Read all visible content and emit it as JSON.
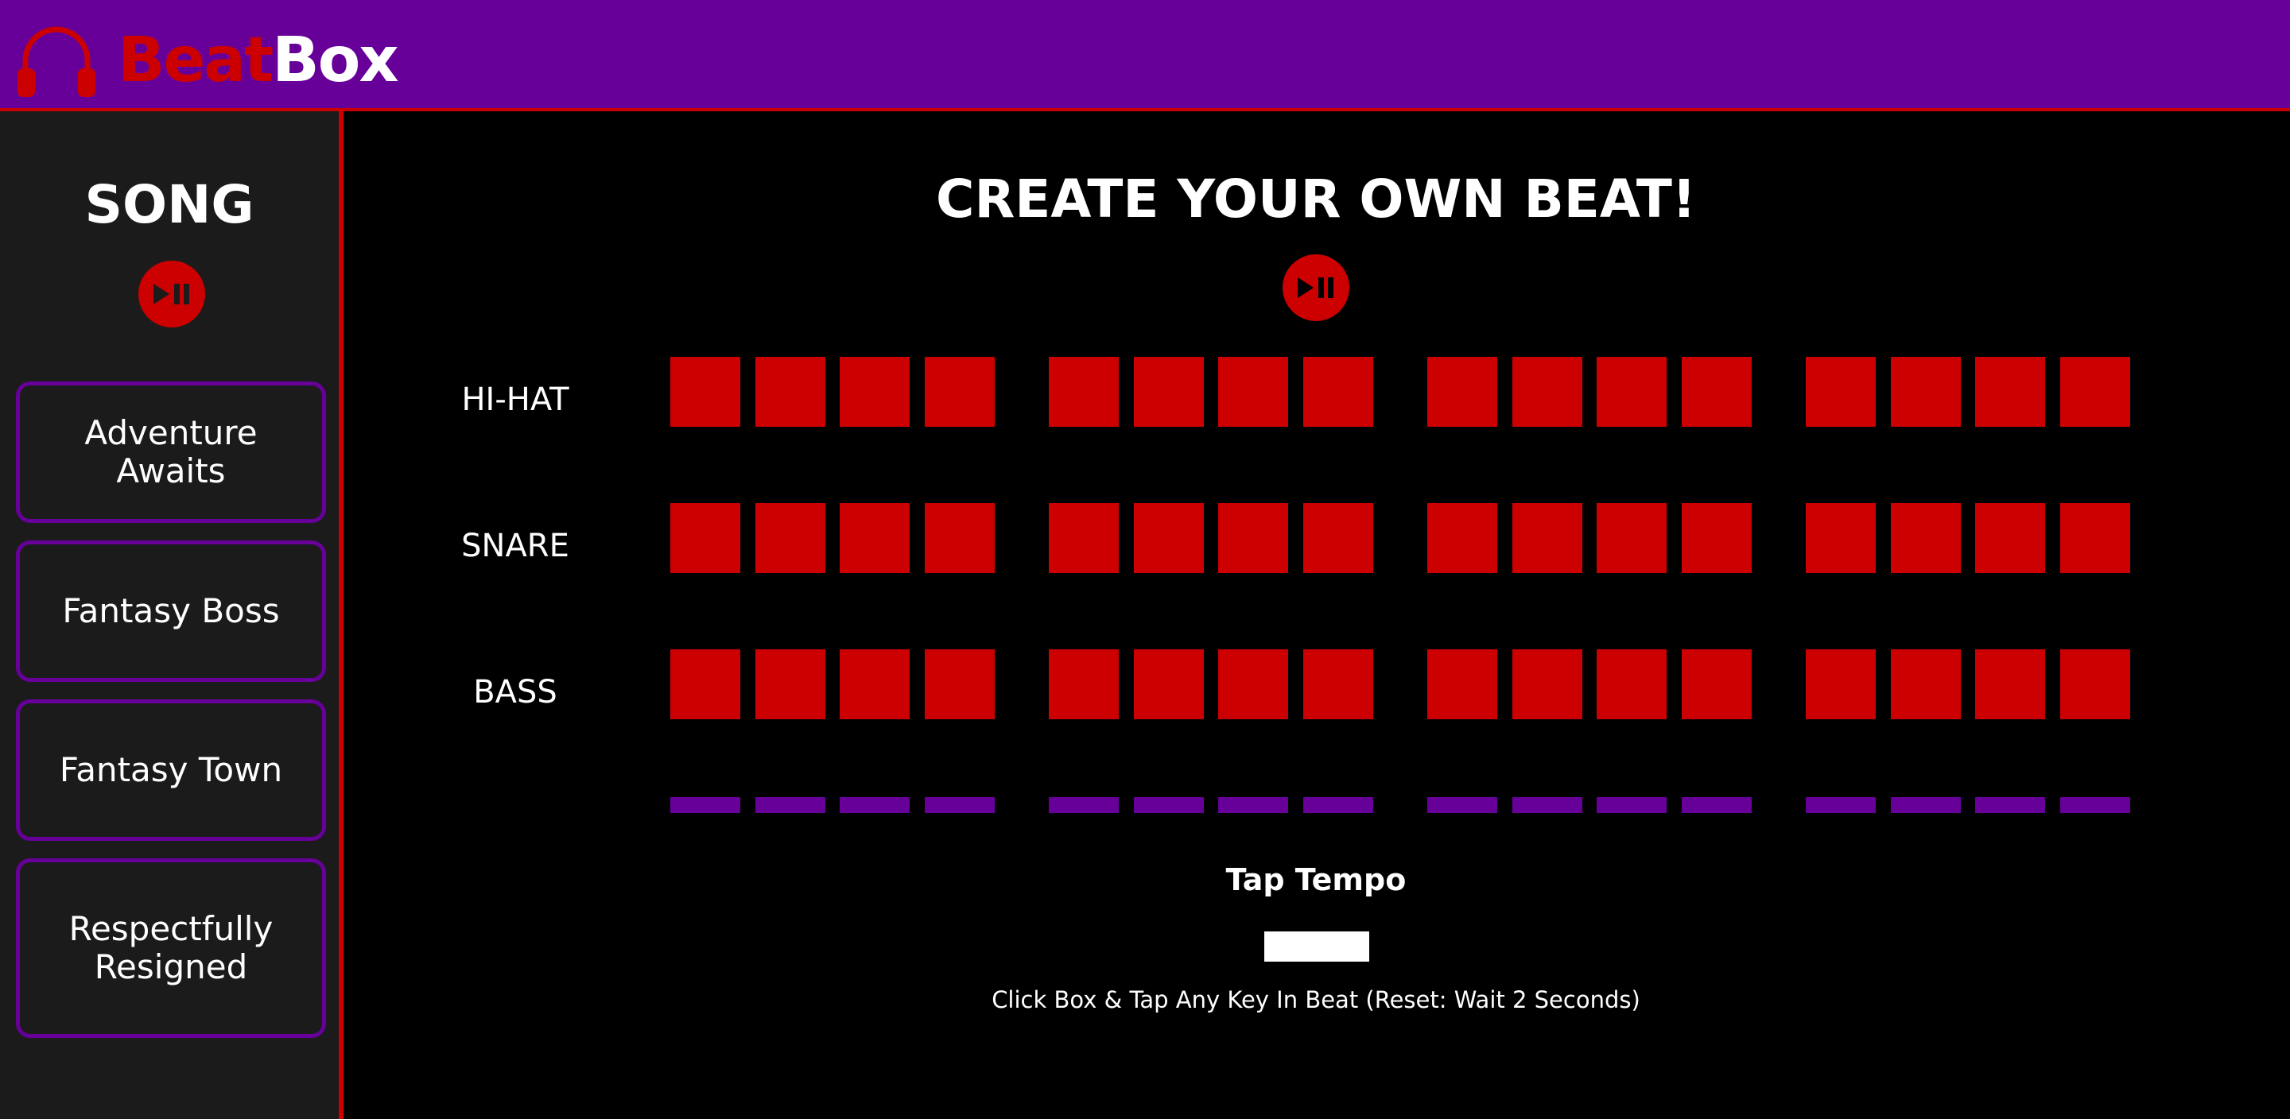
{
  "app": {
    "logo_part1": "Beat",
    "logo_part2": "Box",
    "logo_icon": "headphones-icon",
    "colors": {
      "accent": "#cc0000",
      "brand": "#660099",
      "background": "#000000",
      "sidebar": "#1b1b1b"
    }
  },
  "sidebar": {
    "title": "SONG",
    "play_icon": "play-pause-icon",
    "songs": [
      {
        "label": "Adventure Awaits"
      },
      {
        "label": "Fantasy Boss"
      },
      {
        "label": "Fantasy Town"
      },
      {
        "label": "Respectfully Resigned"
      }
    ]
  },
  "sequencer": {
    "title": "CREATE YOUR OWN BEAT!",
    "play_icon": "play-pause-icon",
    "tracks": [
      {
        "label": "HI-HAT"
      },
      {
        "label": "SNARE"
      },
      {
        "label": "BASS"
      }
    ]
  },
  "tap_tempo": {
    "title": "Tap Tempo",
    "input_value": "",
    "hint": "Click Box & Tap Any Key In Beat (Reset: Wait 2 Seconds)"
  }
}
